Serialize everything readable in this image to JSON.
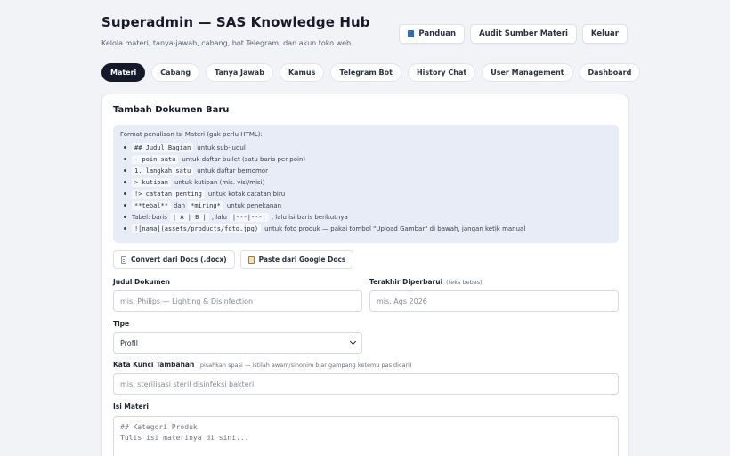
{
  "header": {
    "title": "Superadmin — SAS Knowledge Hub",
    "subtitle": "Kelola materi, tanya-jawab, cabang, bot Telegram, dan akun toko web.",
    "buttons": {
      "panduan": "Panduan",
      "audit": "Audit Sumber Materi",
      "keluar": "Keluar"
    }
  },
  "tabs": [
    "Materi",
    "Cabang",
    "Tanya Jawab",
    "Kamus",
    "Telegram Bot",
    "History Chat",
    "User Management",
    "Dashboard"
  ],
  "active_tab": "Materi",
  "form": {
    "title": "Tambah Dokumen Baru",
    "format": {
      "heading": "Format penulisan Isi Materi (gak perlu HTML):",
      "items": [
        {
          "code": "## Judul Bagian",
          "text": "untuk sub-judul"
        },
        {
          "code": "- poin satu",
          "text": "untuk daftar bullet (satu baris per poin)"
        },
        {
          "code": "1. langkah satu",
          "text": "untuk daftar bernomor"
        },
        {
          "code": "> kutipan",
          "text": "untuk kutipan (mis. visi/misi)"
        },
        {
          "code": "!> catatan penting",
          "text": "untuk kotak catatan biru"
        },
        {
          "code": "**tebal**",
          "mid": "dan",
          "code2": "*miring*",
          "text": "untuk penekanan"
        },
        {
          "prefix": "Tabel: baris",
          "code": "| A | B |",
          "mid": ", lalu",
          "code2": "|---|---|",
          "text": ", lalu isi baris berikutnya"
        },
        {
          "code": "![nama](assets/products/foto.jpg)",
          "text": "untuk foto produk — pakai tombol \"Upload Gambar\" di bawah, jangan ketik manual"
        }
      ]
    },
    "tools": {
      "convert_docx": "Convert dari Docs (.docx)",
      "paste_gdocs": "Paste dari Google Docs"
    },
    "fields": {
      "judul": {
        "label": "Judul Dokumen",
        "placeholder": "mis. Philips — Lighting & Disinfection"
      },
      "terakhir": {
        "label": "Terakhir Diperbarui",
        "hint": "(teks bebas)",
        "placeholder": "mis. Ags 2026"
      },
      "tipe": {
        "label": "Tipe",
        "value": "Profil"
      },
      "kata_kunci": {
        "label": "Kata Kunci Tambahan",
        "hint": "(pisahkan spasi — istilah awam/sinonim biar gampang ketemu pas dicari)",
        "placeholder": "mis. sterilisasi steril disinfeksi bakteri"
      },
      "isi": {
        "label": "Isi Materi",
        "placeholder": "## Kategori Produk\nTulis isi materinya di sini..."
      }
    }
  }
}
